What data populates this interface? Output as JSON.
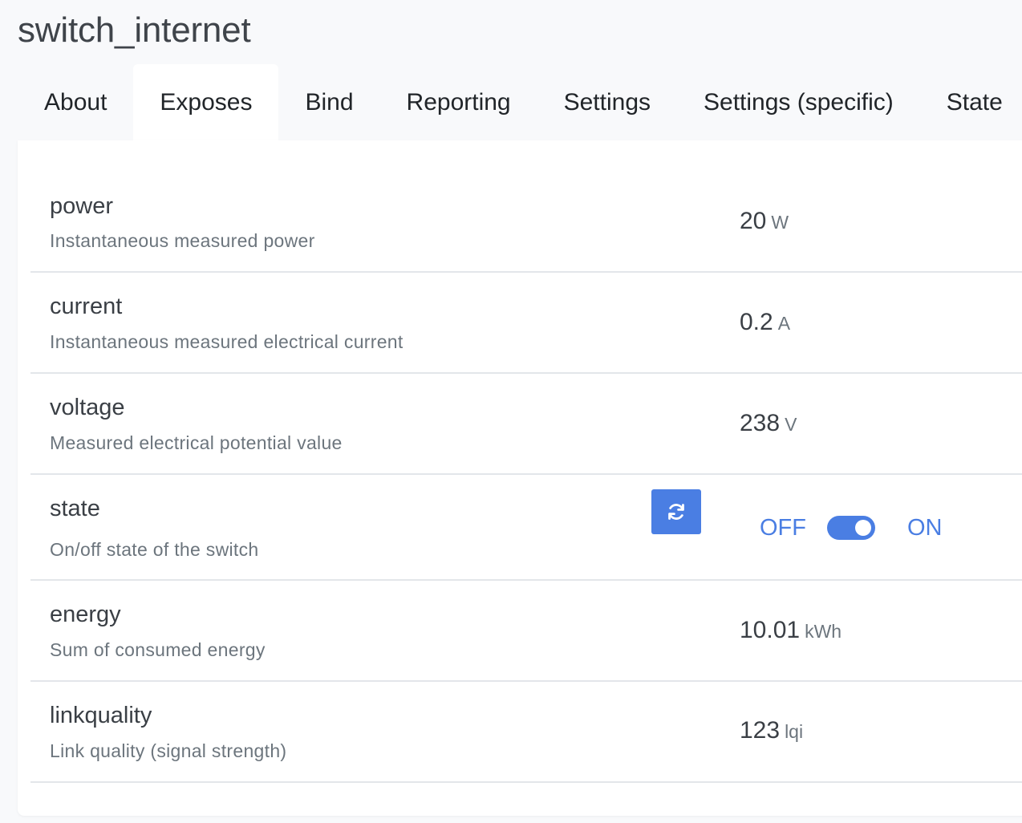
{
  "page": {
    "title": "switch_internet"
  },
  "tabs": [
    {
      "label": "About"
    },
    {
      "label": "Exposes"
    },
    {
      "label": "Bind"
    },
    {
      "label": "Reporting"
    },
    {
      "label": "Settings"
    },
    {
      "label": "Settings (specific)"
    },
    {
      "label": "State"
    }
  ],
  "active_tab": "Exposes",
  "exposes": {
    "power": {
      "name": "power",
      "description": "Instantaneous measured power",
      "value": "20",
      "unit": "W"
    },
    "current": {
      "name": "current",
      "description": "Instantaneous measured electrical current",
      "value": "0.2",
      "unit": "A"
    },
    "voltage": {
      "name": "voltage",
      "description": "Measured electrical potential value",
      "value": "238",
      "unit": "V"
    },
    "state": {
      "name": "state",
      "description": "On/off state of the switch",
      "off_label": "OFF",
      "on_label": "ON",
      "value": "ON",
      "refresh_icon": "refresh-icon"
    },
    "energy": {
      "name": "energy",
      "description": "Sum of consumed energy",
      "value": "10.01",
      "unit": "kWh"
    },
    "linkquality": {
      "name": "linkquality",
      "description": "Link quality (signal strength)",
      "value": "123",
      "unit": "lqi"
    }
  },
  "colors": {
    "accent": "#4a7ee3",
    "title": "#3f444a",
    "muted": "#6c757d",
    "divider": "#e3e6ea",
    "background": "#f8f9fb",
    "card": "#ffffff"
  }
}
